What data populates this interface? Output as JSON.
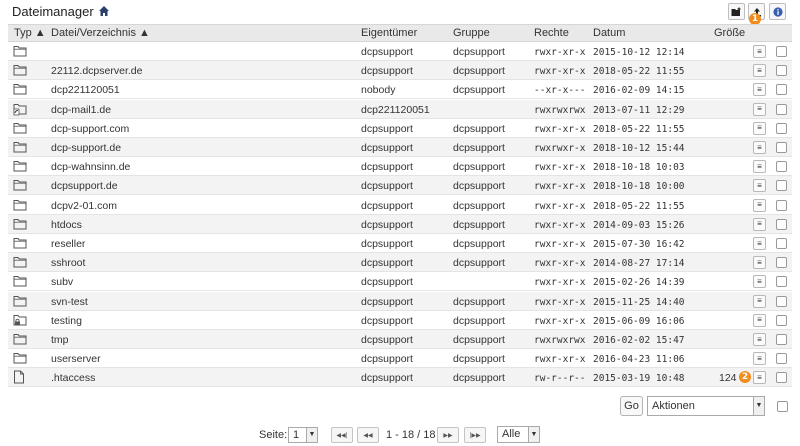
{
  "header": {
    "title": "Dateimanager",
    "home_icon": "home-icon",
    "toolbar": {
      "new_folder_icon": "new-folder-icon",
      "upload_icon": "upload-icon",
      "info_icon": "info-icon",
      "badge_1": "1"
    }
  },
  "table": {
    "columns": {
      "type": "Typ ▲",
      "name": "Datei/Verzeichnis ▲",
      "owner": "Eigentümer",
      "group": "Gruppe",
      "perms": "Rechte",
      "date": "Datum",
      "size": "Größe"
    },
    "rows": [
      {
        "icon": "folder",
        "name": "",
        "owner": "dcpsupport",
        "group": "dcpsupport",
        "perms": "rwxr-xr-x",
        "date": "2015-10-12 12:14",
        "size": ""
      },
      {
        "icon": "folder",
        "name": "22112.dcpserver.de",
        "owner": "dcpsupport",
        "group": "dcpsupport",
        "perms": "rwxr-xr-x",
        "date": "2018-05-22 11:55",
        "size": ""
      },
      {
        "icon": "folder",
        "name": "dcp221120051",
        "owner": "nobody",
        "group": "dcpsupport",
        "perms": "--xr-x---",
        "date": "2016-02-09 14:15",
        "size": ""
      },
      {
        "icon": "folder-link",
        "name": "dcp-mail1.de",
        "owner": "dcp221120051",
        "group": "",
        "perms": "rwxrwxrwx",
        "date": "2013-07-11 12:29",
        "size": ""
      },
      {
        "icon": "folder",
        "name": "dcp-support.com",
        "owner": "dcpsupport",
        "group": "dcpsupport",
        "perms": "rwxr-xr-x",
        "date": "2018-05-22 11:55",
        "size": ""
      },
      {
        "icon": "folder",
        "name": "dcp-support.de",
        "owner": "dcpsupport",
        "group": "dcpsupport",
        "perms": "rwxrwxr-x",
        "date": "2018-10-12 15:44",
        "size": ""
      },
      {
        "icon": "folder",
        "name": "dcp-wahnsinn.de",
        "owner": "dcpsupport",
        "group": "dcpsupport",
        "perms": "rwxr-xr-x",
        "date": "2018-10-18 10:03",
        "size": ""
      },
      {
        "icon": "folder",
        "name": "dcpsupport.de",
        "owner": "dcpsupport",
        "group": "dcpsupport",
        "perms": "rwxr-xr-x",
        "date": "2018-10-18 10:00",
        "size": ""
      },
      {
        "icon": "folder",
        "name": "dcpv2-01.com",
        "owner": "dcpsupport",
        "group": "dcpsupport",
        "perms": "rwxr-xr-x",
        "date": "2018-05-22 11:55",
        "size": ""
      },
      {
        "icon": "folder",
        "name": "htdocs",
        "owner": "dcpsupport",
        "group": "dcpsupport",
        "perms": "rwxr-xr-x",
        "date": "2014-09-03 15:26",
        "size": ""
      },
      {
        "icon": "folder",
        "name": "reseller",
        "owner": "dcpsupport",
        "group": "dcpsupport",
        "perms": "rwxr-xr-x",
        "date": "2015-07-30 16:42",
        "size": ""
      },
      {
        "icon": "folder",
        "name": "sshroot",
        "owner": "dcpsupport",
        "group": "dcpsupport",
        "perms": "rwxr-xr-x",
        "date": "2014-08-27 17:14",
        "size": ""
      },
      {
        "icon": "folder",
        "name": "subv",
        "owner": "dcpsupport",
        "group": "",
        "perms": "rwxr-xr-x",
        "date": "2015-02-26 14:39",
        "size": ""
      },
      {
        "icon": "folder",
        "name": "svn-test",
        "owner": "dcpsupport",
        "group": "dcpsupport",
        "perms": "rwxr-xr-x",
        "date": "2015-11-25 14:40",
        "size": ""
      },
      {
        "icon": "folder-lock",
        "name": "testing",
        "owner": "dcpsupport",
        "group": "dcpsupport",
        "perms": "rwxr-xr-x",
        "date": "2015-06-09 16:06",
        "size": ""
      },
      {
        "icon": "folder",
        "name": "tmp",
        "owner": "dcpsupport",
        "group": "dcpsupport",
        "perms": "rwxrwxrwx",
        "date": "2016-02-02 15:47",
        "size": ""
      },
      {
        "icon": "folder",
        "name": "userserver",
        "owner": "dcpsupport",
        "group": "dcpsupport",
        "perms": "rwxr-xr-x",
        "date": "2016-04-23 11:06",
        "size": ""
      },
      {
        "icon": "file",
        "name": ".htaccess",
        "owner": "dcpsupport",
        "group": "dcpsupport",
        "perms": "rw-r--r--",
        "date": "2015-03-19 10:48",
        "size": "124",
        "badge": "2"
      }
    ],
    "row_menu_glyph": "≡"
  },
  "actions": {
    "go_label": "Go",
    "select_value": "Aktionen"
  },
  "pager": {
    "page_label": "Seite:",
    "page_value": "1",
    "first": "◀◀|",
    "prev": "◀◀",
    "range": "1 - 18 / 18",
    "next": "▶▶",
    "last": "|▶▶",
    "per_page": "Alle"
  },
  "colors": {
    "badge": "#f28c1c",
    "header_bg": "#e9e9e9",
    "row_alt": "#f3f3f3"
  }
}
